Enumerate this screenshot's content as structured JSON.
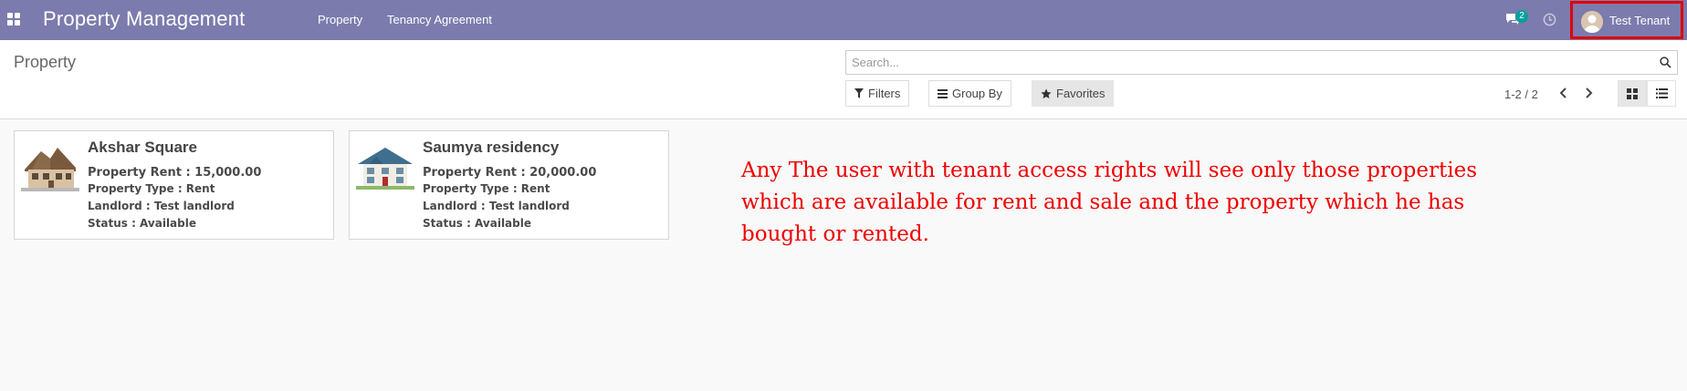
{
  "navbar": {
    "app_title": "Property Management",
    "menu": [
      "Property",
      "Tenancy Agreement"
    ],
    "chat_count": "2",
    "user_name": "Test Tenant",
    "color": "#7c7bad"
  },
  "control_panel": {
    "breadcrumb": "Property",
    "search_placeholder": "Search...",
    "filters_label": "Filters",
    "group_by_label": "Group By",
    "favorites_label": "Favorites",
    "pager_value": "1-2 / 2"
  },
  "cards": [
    {
      "name": "Akshar Square",
      "rent": "Property Rent : 15,000.00",
      "type": "Property Type : Rent",
      "landlord": "Landlord : Test landlord",
      "status": "Status : Available"
    },
    {
      "name": "Saumya residency",
      "rent": "Property Rent : 20,000.00",
      "type": "Property Type : Rent",
      "landlord": "Landlord : Test landlord",
      "status": "Status : Available"
    }
  ],
  "annotation": "Any The user with tenant access rights will see only those properties which are available for rent and sale and the property which he has bought or rented.",
  "colors": {
    "highlight": "#e00000",
    "annotation": "#ee0000",
    "badge": "#00a09d"
  }
}
